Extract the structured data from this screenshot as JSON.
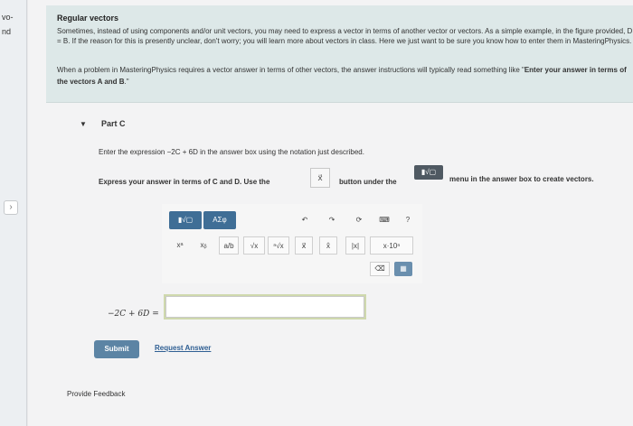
{
  "left_strip": {
    "fragment_top": "vo-",
    "fragment_second": "nd",
    "arrow_icon": "chevron-right-icon"
  },
  "info": {
    "title": "Regular vectors",
    "p1": "Sometimes, instead of using components and/or unit vectors, you may need to express a vector in terms of another vector or vectors. As a simple example, in the figure provided, D = B. If the reason for this is presently unclear, don't worry; you will learn more about vectors in class. Here we just want to be sure you know how to enter them in MasteringPhysics.",
    "p2_a": "When a problem in MasteringPhysics requires a vector answer in terms of other vectors, the answer instructions will typically read something like \"",
    "p2_b": "Enter your answer in terms of the vectors A and B",
    "p2_c": ".\""
  },
  "part": {
    "caret": "▼",
    "title": "Part C"
  },
  "prompts": {
    "line1": "Enter the expression −2C + 6D in the answer box using the notation just described.",
    "line2_start": "Express your answer in terms of C and D. Use the",
    "line2_mid": "button under the",
    "line2_end": "menu in the answer box to create vectors."
  },
  "inline": {
    "vector_button": "x⃗",
    "menu_label": "▮√▢"
  },
  "toolbar": {
    "templates": "▮√▢",
    "symbols": "ΑΣφ",
    "undo": "↶",
    "redo": "↷",
    "reset": "⟳",
    "keyboard": "⌨",
    "help": "?",
    "superscript": "xᵃ",
    "subscript": "xᵦ",
    "fraction": "a/b",
    "sqrt": "√x",
    "nthroot": "ⁿ√x",
    "vector": "x⃗",
    "unitvector": "x̂",
    "abs": "|x|",
    "sci": "x·10ⁿ",
    "backspace": "⌫",
    "keypad": "▦"
  },
  "answer": {
    "label": "−2C + 6D =",
    "value": "",
    "placeholder": ""
  },
  "actions": {
    "submit": "Submit",
    "request": "Request Answer"
  },
  "footer": {
    "feedback": "Provide Feedback"
  }
}
